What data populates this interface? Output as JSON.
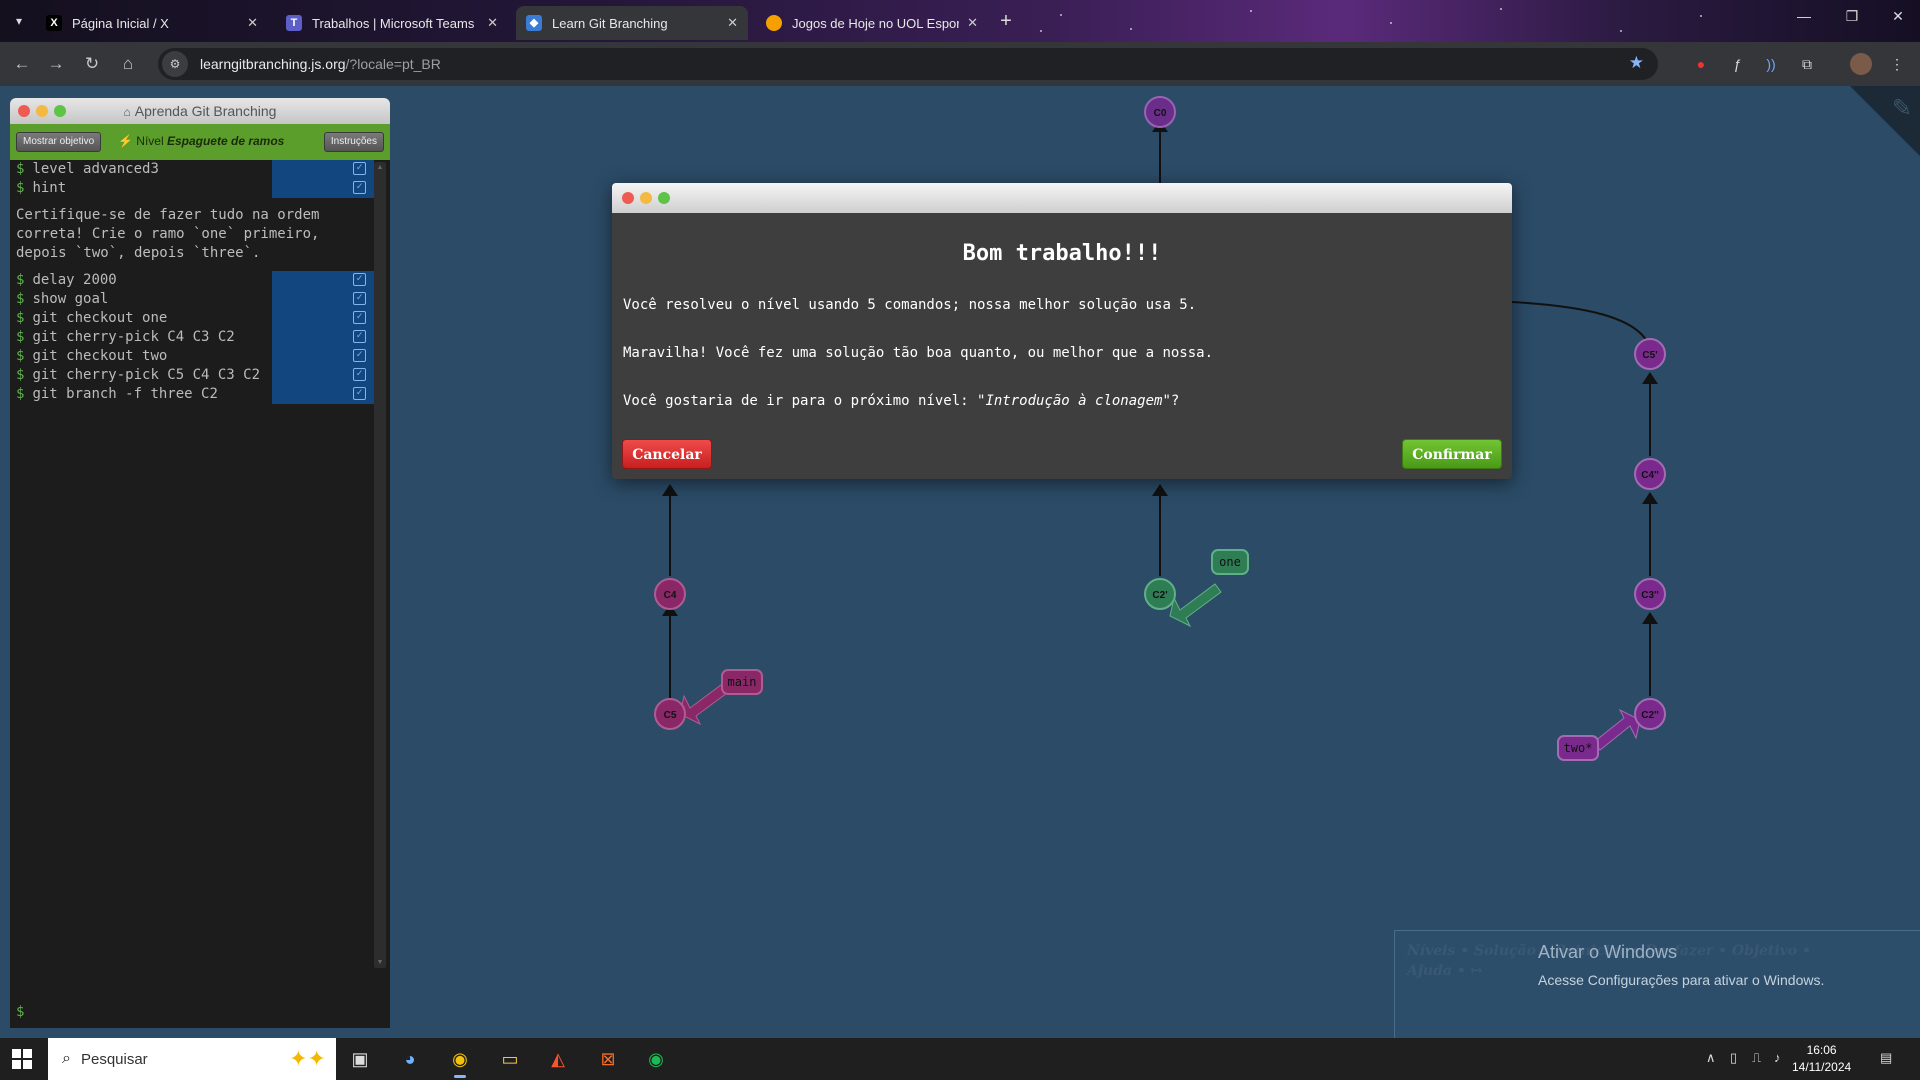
{
  "browser": {
    "tabs": [
      {
        "label": "Página Inicial / X",
        "favicon": "x-logo-icon"
      },
      {
        "label": "Trabalhos | Microsoft Teams",
        "favicon": "teams-icon"
      },
      {
        "label": "Learn Git Branching",
        "favicon": "git-icon"
      },
      {
        "label": "Jogos de Hoje no UOL Esporte",
        "favicon": "uol-icon"
      }
    ],
    "url_domain": "learngitbranching.js.org",
    "url_path": "/?locale=pt_BR"
  },
  "terminal": {
    "title": "Aprenda Git Branching",
    "show_goal_btn": "Mostrar objetivo",
    "level_prefix": "Nível",
    "level_name": "Espaguete de ramos",
    "instructions_btn": "Instruções",
    "commands_top": [
      "level advanced3",
      "hint"
    ],
    "hint": "Certifique-se de fazer tudo na ordem\ncorreta! Crie o ramo `one` primeiro,\ndepois `two`, depois `three`.",
    "commands": [
      "delay 2000",
      "show goal",
      "git checkout one",
      "git cherry-pick C4 C3 C2",
      "git checkout two",
      "git cherry-pick C5 C4 C3 C2",
      "git branch -f three C2"
    ],
    "prompt": "$"
  },
  "graph": {
    "commits": [
      "C0",
      "C4",
      "C5",
      "C2'",
      "C5'",
      "C4''",
      "C3''",
      "C2''"
    ],
    "branches": [
      "main",
      "one",
      "two*"
    ]
  },
  "dialog": {
    "title": "Bom trabalho!!!",
    "line1": "Você resolveu o nível usando 5 comandos; nossa melhor solução usa 5.",
    "line2": "Maravilha! Você fez uma solução tão boa quanto, ou melhor que a nossa.",
    "line3_prefix": "Você gostaria de ir para o próximo nível: ",
    "line3_level": "\"Introdução à clonagem\"",
    "line3_suffix": "?",
    "cancel": "Cancelar",
    "confirm": "Confirmar"
  },
  "help": {
    "line1": "Níveis • Solução • Reiniciar • Desfazer • Objetivo •",
    "line2": "Ajuda •"
  },
  "watermark": {
    "title": "Ativar o Windows",
    "subtitle": "Acesse Configurações para ativar o Windows."
  },
  "taskbar": {
    "search_placeholder": "Pesquisar",
    "time": "16:06",
    "date": "14/11/2024"
  },
  "colors": {
    "background": "#2b4b66",
    "main_branch_commits": "#8a2767",
    "one_branch_commits": "#2e7d55",
    "two_branch_commits": "#7a2a8c"
  }
}
